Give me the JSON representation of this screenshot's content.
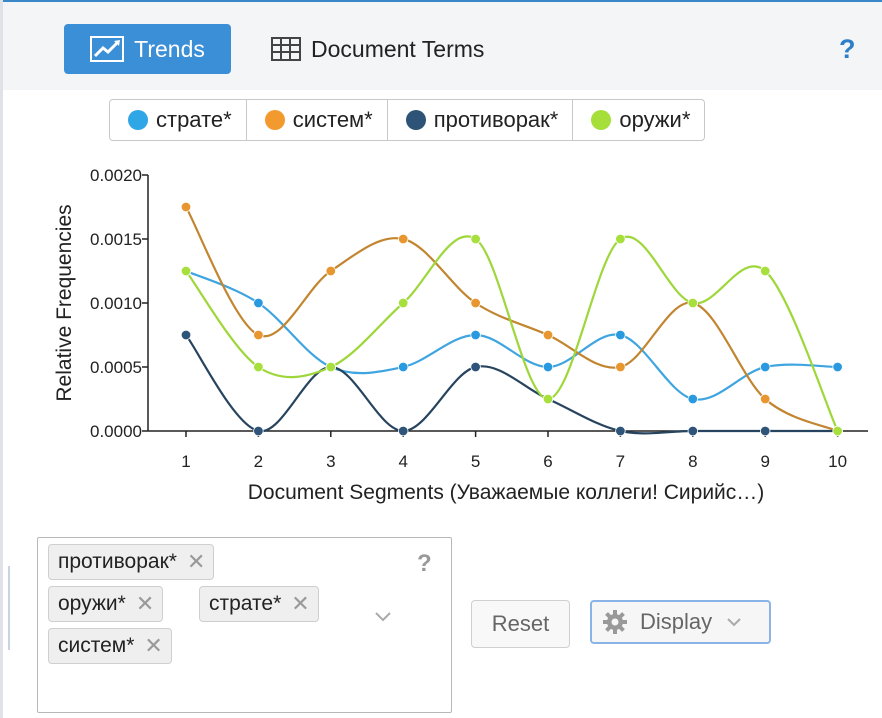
{
  "tabs": {
    "trends": "Trends",
    "document_terms": "Document Terms",
    "help": "?"
  },
  "legend": [
    {
      "label": "страте*",
      "color": "#2fa6e6"
    },
    {
      "label": "систем*",
      "color": "#f29a2e"
    },
    {
      "label": "противорак*",
      "color": "#2d5377"
    },
    {
      "label": "оружи*",
      "color": "#a6df3a"
    }
  ],
  "chart_data": {
    "type": "line",
    "xlabel": "Document Segments (Уважаемые коллеги! Сирийс…)",
    "ylabel": "Relative Frequencies",
    "categories": [
      "1",
      "2",
      "3",
      "4",
      "5",
      "6",
      "7",
      "8",
      "9",
      "10"
    ],
    "ylim": [
      0,
      0.002
    ],
    "yticks": [
      "0.0000",
      "0.0005",
      "0.0010",
      "0.0015",
      "0.0020"
    ],
    "grid": false,
    "series": [
      {
        "name": "страте*",
        "color": "#2fa6e6",
        "line_color": "#3fa5e0",
        "point_color": "#2a9ae0",
        "values": [
          0.00125,
          0.001,
          0.0005,
          0.0005,
          0.00075,
          0.0005,
          0.00075,
          0.00025,
          0.0005,
          0.0005
        ]
      },
      {
        "name": "систем*",
        "color": "#f29a2e",
        "line_color": "#c28530",
        "point_color": "#e8962f",
        "values": [
          0.00175,
          0.00075,
          0.00125,
          0.0015,
          0.001,
          0.00075,
          0.0005,
          0.001,
          0.00025,
          0.0
        ]
      },
      {
        "name": "противорак*",
        "color": "#2d5377",
        "line_color": "#27445f",
        "point_color": "#2e5479",
        "values": [
          0.00075,
          0.0,
          0.0005,
          0.0,
          0.0005,
          0.00025,
          0.0,
          0.0,
          0.0,
          0.0
        ]
      },
      {
        "name": "оружи*",
        "color": "#a6df3a",
        "line_color": "#9ed73a",
        "point_color": "#a7df3c",
        "values": [
          0.00125,
          0.0005,
          0.0005,
          0.001,
          0.0015,
          0.00025,
          0.0015,
          0.001,
          0.00125,
          0.0
        ]
      }
    ]
  },
  "terms": {
    "chips": [
      "противорак*",
      "оружи*",
      "страте*",
      "систем*"
    ],
    "remove_symbol": "✕",
    "help": "?"
  },
  "buttons": {
    "reset": "Reset",
    "display": "Display"
  }
}
